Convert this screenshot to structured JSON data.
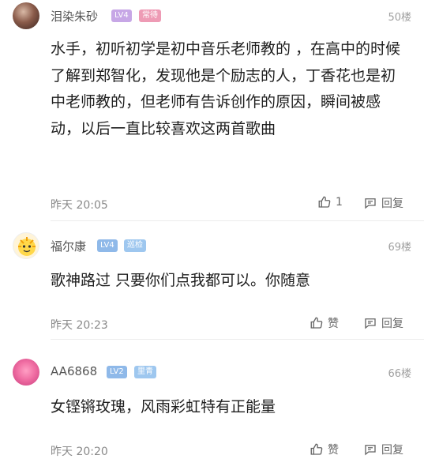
{
  "comments": [
    {
      "username": "泪染朱砂",
      "level": "LV4",
      "tag": "常待",
      "floor": "50楼",
      "content": "水手，初听初学是初中音乐老师教的 ，在高中的时候了解到郑智化，发现他是个励志的人，丁香花也是初中老师教的，但老师有告诉创作的原因，瞬间被感动，以后一直比较喜欢这两首歌曲",
      "time": "昨天 20:05",
      "like": "1",
      "reply": "回复"
    },
    {
      "username": "福尔康",
      "level": "LV4",
      "tag": "巡检",
      "floor": "69楼",
      "content": "歌神路过 只要你们点我都可以。你随意",
      "time": "昨天 20:23",
      "like": "赞",
      "reply": "回复"
    },
    {
      "username": "AA6868",
      "level": "LV2",
      "tag": "里青",
      "floor": "66楼",
      "content": "女铿锵玫瑰，风雨彩虹特有正能量",
      "time": "昨天 20:20",
      "like": "赞",
      "reply": "回复"
    }
  ],
  "colors": {
    "lv4": "#c7a7e6",
    "lv2": "#8fb9e9",
    "tag_changdai": "#ee9bb5",
    "tag_blue": "#9ec7ef"
  },
  "icons": {
    "like": "thumbs-up-icon",
    "reply": "comment-bubble-icon"
  }
}
